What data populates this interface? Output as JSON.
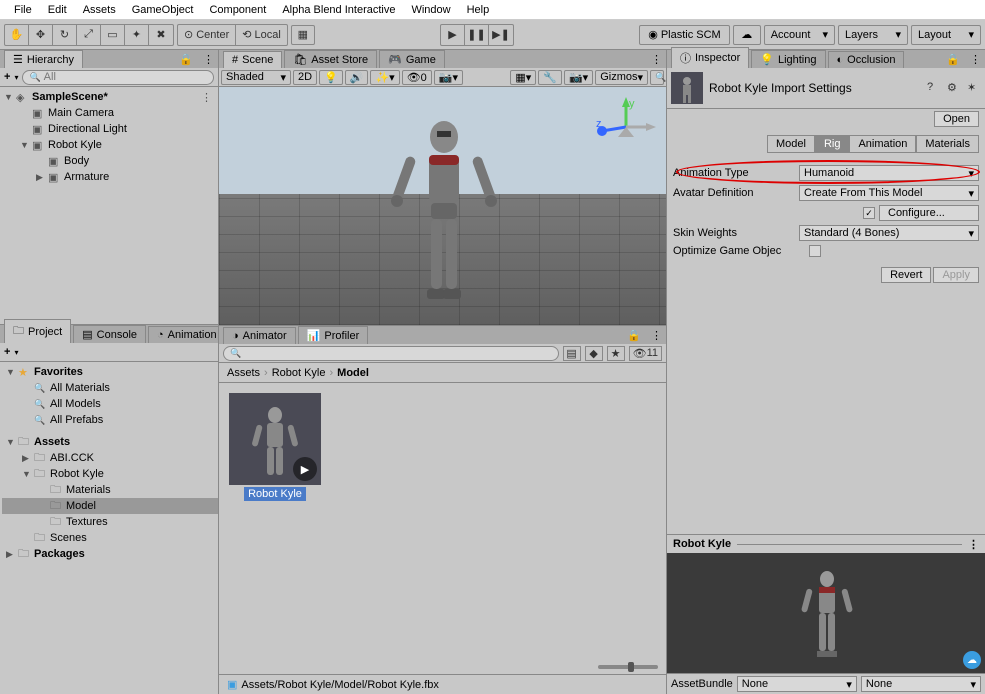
{
  "menubar": [
    "File",
    "Edit",
    "Assets",
    "GameObject",
    "Component",
    "Alpha Blend Interactive",
    "Window",
    "Help"
  ],
  "toolbar": {
    "center": "Center",
    "local": "Local",
    "collab": "Plastic SCM",
    "account": "Account",
    "layers": "Layers",
    "layout": "Layout"
  },
  "hierarchy": {
    "title": "Hierarchy",
    "add": "+",
    "all": "All",
    "items": [
      {
        "label": "SampleScene*",
        "icon": "unity",
        "arrow": "▼",
        "indent": 0,
        "bold": true
      },
      {
        "label": "Main Camera",
        "icon": "cube",
        "arrow": "",
        "indent": 1
      },
      {
        "label": "Directional Light",
        "icon": "cube",
        "arrow": "",
        "indent": 1
      },
      {
        "label": "Robot Kyle",
        "icon": "cube",
        "arrow": "▼",
        "indent": 1
      },
      {
        "label": "Body",
        "icon": "cube",
        "arrow": "",
        "indent": 2
      },
      {
        "label": "Armature",
        "icon": "cube",
        "arrow": "▶",
        "indent": 2
      }
    ]
  },
  "scene": {
    "tabs": [
      "Scene",
      "Asset Store",
      "Game"
    ],
    "shading": "Shaded",
    "twod": "2D",
    "gizmos": "Gizmos"
  },
  "project": {
    "tabs": [
      "Project",
      "Console",
      "Animation",
      "Animator",
      "Profiler"
    ],
    "add": "+",
    "favorites": "Favorites",
    "fav_items": [
      "All Materials",
      "All Models",
      "All Prefabs"
    ],
    "assets": "Assets",
    "asset_tree": [
      {
        "label": "ABI.CCK",
        "arrow": "▶",
        "indent": 1
      },
      {
        "label": "Robot Kyle",
        "arrow": "▼",
        "indent": 1
      },
      {
        "label": "Materials",
        "arrow": "",
        "indent": 2
      },
      {
        "label": "Model",
        "arrow": "",
        "indent": 2,
        "selected": true
      },
      {
        "label": "Textures",
        "arrow": "",
        "indent": 2
      },
      {
        "label": "Scenes",
        "arrow": "",
        "indent": 1
      }
    ],
    "packages": "Packages",
    "breadcrumb": [
      "Assets",
      "Robot Kyle",
      "Model"
    ],
    "asset": {
      "name": "Robot Kyle"
    },
    "status": "Assets/Robot Kyle/Model/Robot Kyle.fbx",
    "hidden_count": "11"
  },
  "inspector": {
    "tabs": [
      "Inspector",
      "Lighting",
      "Occlusion"
    ],
    "title": "Robot Kyle Import Settings",
    "open": "Open",
    "model_tabs": [
      "Model",
      "Rig",
      "Animation",
      "Materials"
    ],
    "active_tab": "Rig",
    "fields": {
      "anim_type_label": "Animation Type",
      "anim_type": "Humanoid",
      "avatar_label": "Avatar Definition",
      "avatar": "Create From This Model",
      "configure": "Configure...",
      "skin_label": "Skin Weights",
      "skin": "Standard (4 Bones)",
      "optimize_label": "Optimize Game Objec"
    },
    "revert": "Revert",
    "apply": "Apply",
    "preview_title": "Robot Kyle",
    "bundle_label": "AssetBundle",
    "bundle": "None",
    "bundle_variant": "None"
  }
}
